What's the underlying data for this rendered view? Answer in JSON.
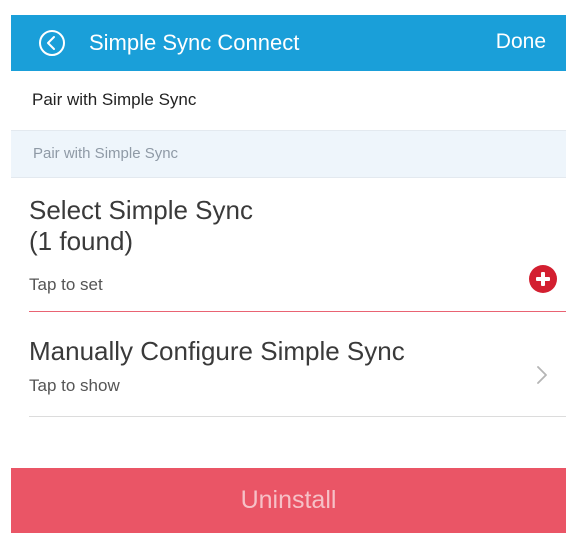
{
  "header": {
    "title": "Simple Sync Connect",
    "done_label": "Done",
    "back_icon": "circle-chevron-left-icon",
    "background_color": "#1a9fd9"
  },
  "section": {
    "title": "Pair with Simple Sync"
  },
  "pair_input": {
    "placeholder": "Pair with Simple Sync",
    "value": ""
  },
  "select_item": {
    "title_line1": "Select Simple Sync",
    "title_line2": "(1 found)",
    "subtitle": "Tap to set",
    "action_icon": "add-circle-icon",
    "accent_color": "#d31f30"
  },
  "manual_item": {
    "title": "Manually Configure Simple Sync",
    "subtitle": "Tap to show",
    "icon": "chevron-right-icon"
  },
  "uninstall": {
    "label": "Uninstall",
    "color": "#ea5566"
  }
}
